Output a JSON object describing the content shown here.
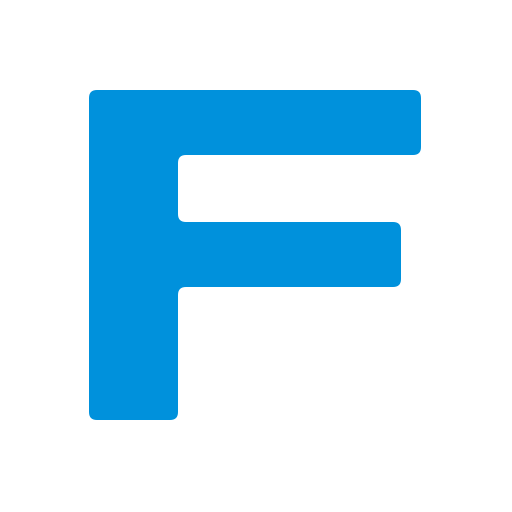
{
  "logo": {
    "letter": "F",
    "icon": "letter-f-logo-icon",
    "color": "#0091dc",
    "background": "#ffffff"
  }
}
